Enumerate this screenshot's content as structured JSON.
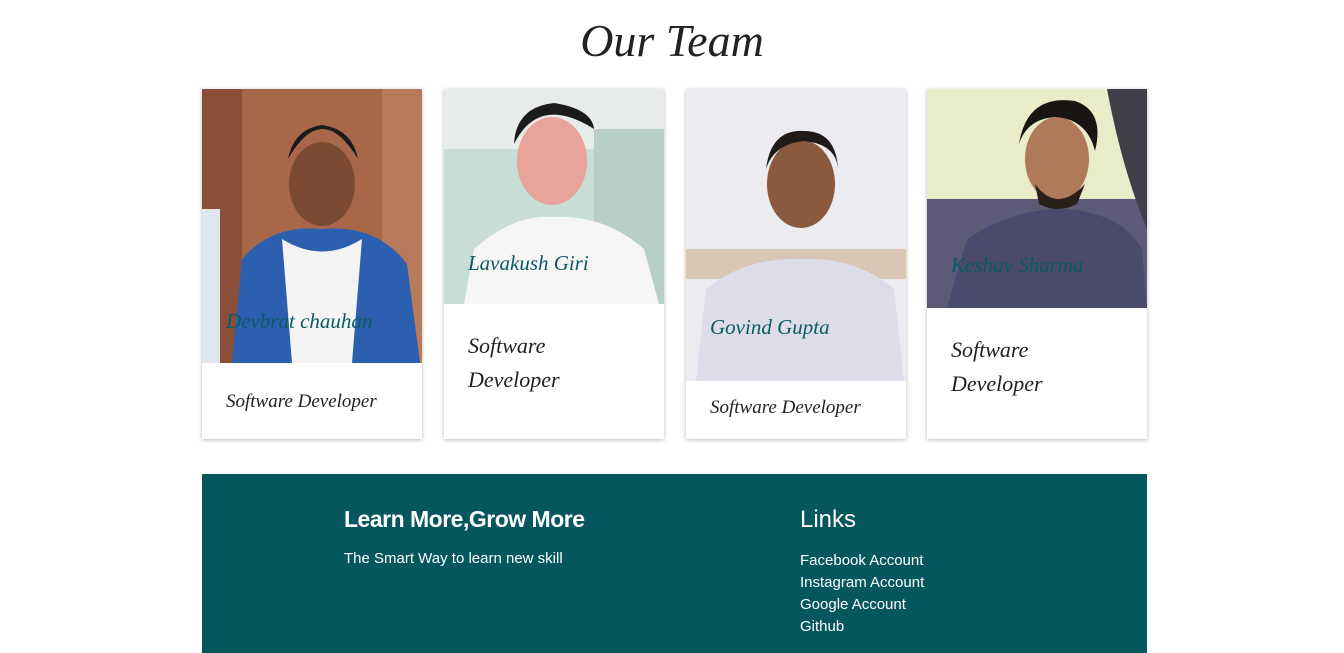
{
  "page_title": "Our Team",
  "team": [
    {
      "name": "Devbrat chauhan",
      "role": "Software Developer"
    },
    {
      "name": "Lavakush Giri",
      "role": "Software Developer"
    },
    {
      "name": "Govind Gupta",
      "role": "Software Developer"
    },
    {
      "name": "Keshav Sharma",
      "role": "Software Developer"
    }
  ],
  "footer": {
    "title": "Learn More,Grow More",
    "tagline": "The Smart Way to learn new skill",
    "links_title": "Links",
    "links": [
      "Facebook Account",
      "Instagram Account",
      "Google Account",
      "Github"
    ]
  },
  "colors": {
    "footer_bg": "#05575e",
    "name_text": "#0b5a63"
  }
}
